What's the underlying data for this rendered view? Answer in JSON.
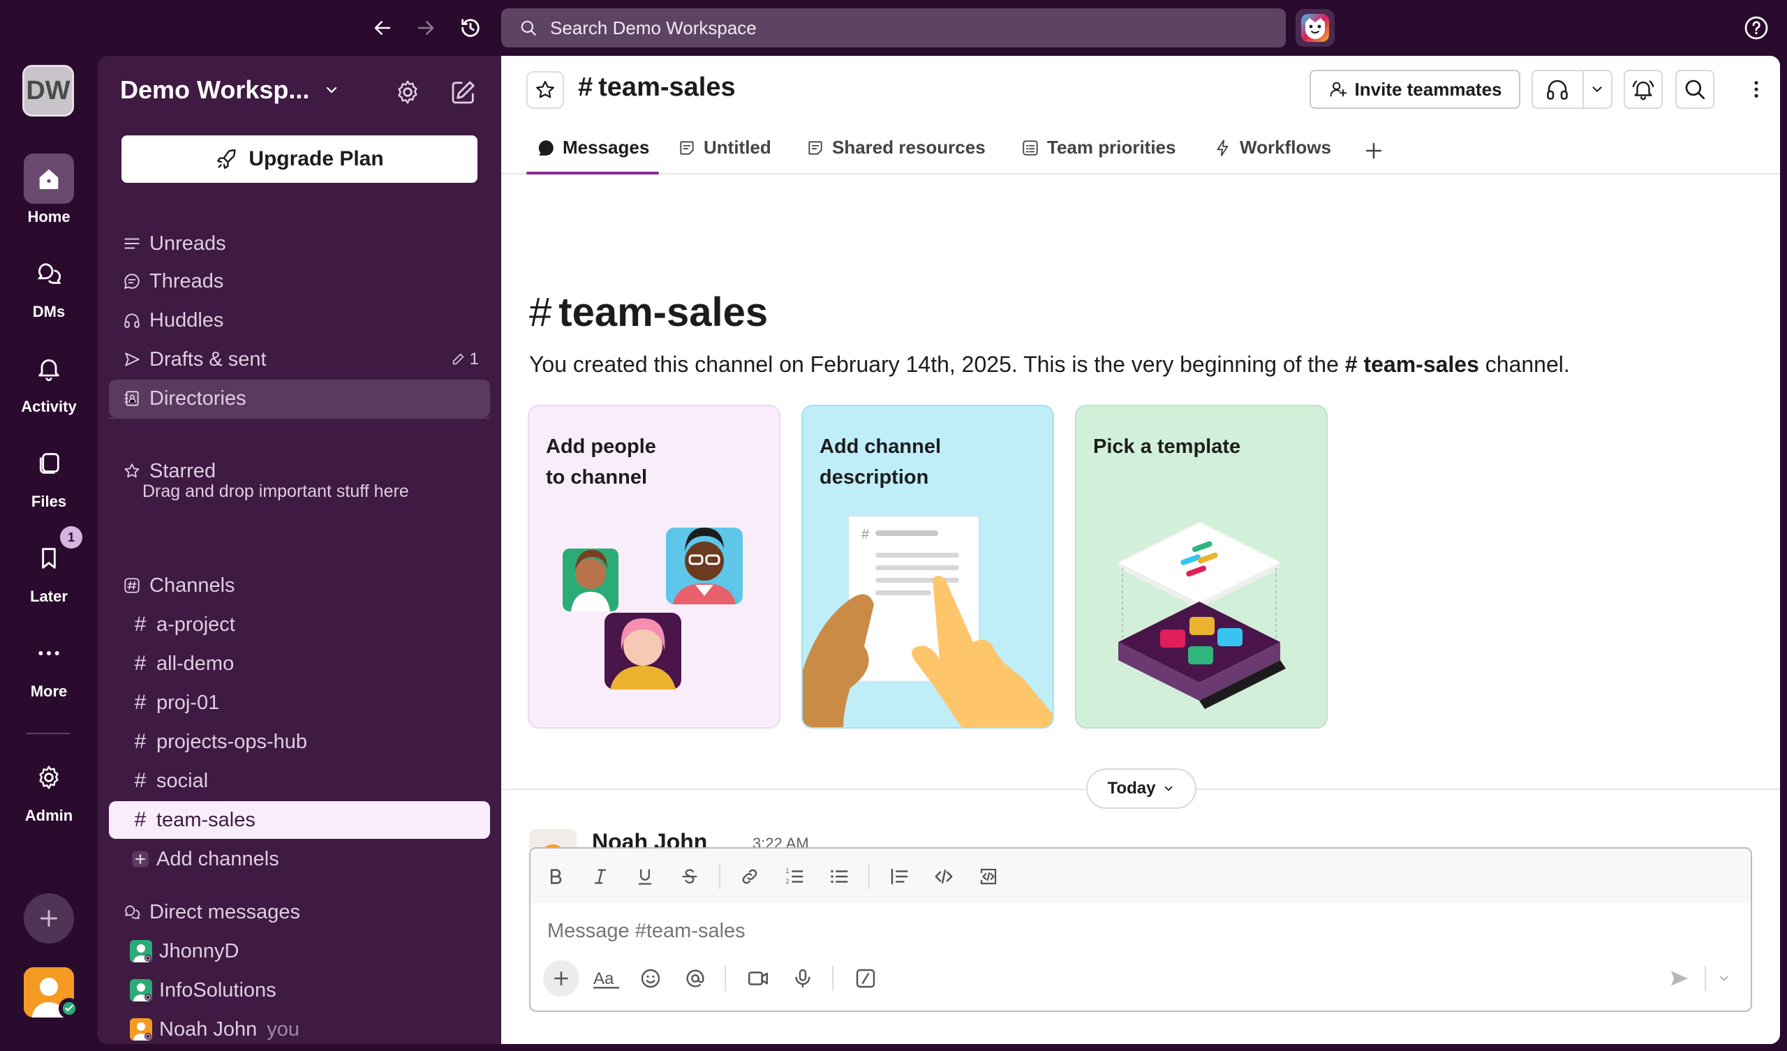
{
  "topbar": {
    "search_placeholder": "Search Demo Workspace",
    "icons": [
      "back-arrow-icon",
      "forward-arrow-icon",
      "history-icon",
      "search-icon",
      "ai-assistant-icon",
      "help-icon"
    ]
  },
  "rail": {
    "workspace_initials": "DW",
    "items": [
      {
        "label": "Home",
        "icon": "home-icon",
        "active": true
      },
      {
        "label": "DMs",
        "icon": "dm-icon"
      },
      {
        "label": "Activity",
        "icon": "bell-icon"
      },
      {
        "label": "Files",
        "icon": "files-icon"
      },
      {
        "label": "Later",
        "icon": "bookmark-icon",
        "badge": "1"
      },
      {
        "label": "More",
        "icon": "more-icon"
      },
      {
        "label": "Admin",
        "icon": "gear-icon"
      }
    ]
  },
  "sidebar": {
    "workspace_name": "Demo Worksp...",
    "upgrade_label": "Upgrade Plan",
    "nav": [
      {
        "label": "Unreads",
        "icon": "unreads-icon"
      },
      {
        "label": "Threads",
        "icon": "threads-icon"
      },
      {
        "label": "Huddles",
        "icon": "headphones-icon"
      },
      {
        "label": "Drafts & sent",
        "icon": "send-icon",
        "count": "1"
      },
      {
        "label": "Directories",
        "icon": "directory-icon"
      }
    ],
    "starred": {
      "label": "Starred",
      "hint": "Drag and drop important stuff here"
    },
    "channels_label": "Channels",
    "channels": [
      "a-project",
      "all-demo",
      "proj-01",
      "projects-ops-hub",
      "social",
      "team-sales"
    ],
    "active_channel": "team-sales",
    "add_channels_label": "Add channels",
    "dm_label": "Direct messages",
    "dms": [
      {
        "name": "JhonnyD",
        "suffix": ""
      },
      {
        "name": "InfoSolutions",
        "suffix": ""
      },
      {
        "name": "Noah John",
        "suffix": "you"
      }
    ]
  },
  "header": {
    "channel_name": "team-sales",
    "invite_label": "Invite teammates"
  },
  "tabs": [
    {
      "label": "Messages",
      "icon": "messages-icon",
      "active": true
    },
    {
      "label": "Untitled",
      "icon": "canvas-icon"
    },
    {
      "label": "Shared resources",
      "icon": "canvas-icon"
    },
    {
      "label": "Team priorities",
      "icon": "list-icon"
    },
    {
      "label": "Workflows",
      "icon": "bolt-icon"
    }
  ],
  "intro": {
    "title": "team-sales",
    "desc_before": "You created this channel on February 14th, 2025. This is the very beginning of the ",
    "desc_channel": "team-sales",
    "desc_after": " channel."
  },
  "cards": [
    {
      "title": "Add people\nto channel",
      "bg": "#f9edfb"
    },
    {
      "title": "Add channel\ndescription",
      "bg": "#bfedf8"
    },
    {
      "title": "Pick a template",
      "bg": "#d2f0d9"
    }
  ],
  "divider_label": "Today",
  "message_preview": {
    "author": "Noah John",
    "time": "3:22 AM"
  },
  "composer": {
    "placeholder": "Message #team-sales"
  },
  "colors": {
    "aubergine": "#3f1a43",
    "rail": "#2a0b2e",
    "accent": "#8a2b92"
  }
}
